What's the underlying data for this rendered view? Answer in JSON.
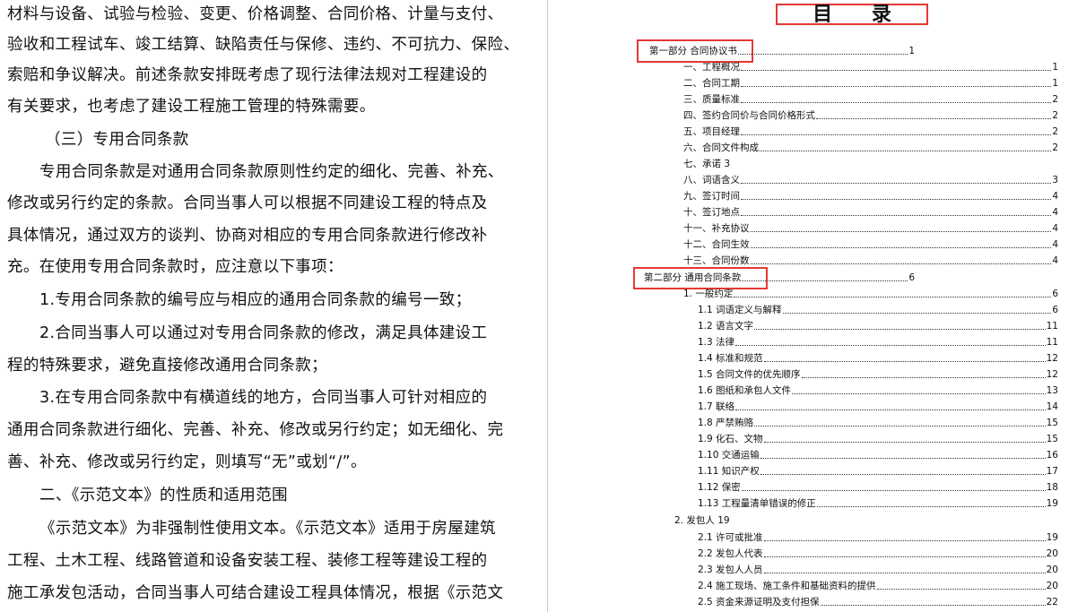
{
  "left_page": {
    "lines": [
      "材料与设备、试验与检验、变更、价格调整、合同价格、计量与支付、",
      "验收和工程试车、竣工结算、缺陷责任与保修、违约、不可抗力、保险、",
      "索赔和争议解决。前述条款安排既考虑了现行法律法规对工程建设的",
      "有关要求，也考虑了建设工程施工管理的特殊需要。",
      "（三）专用合同条款",
      "专用合同条款是对通用合同条款原则性约定的细化、完善、补充、",
      "修改或另行约定的条款。合同当事人可以根据不同建设工程的特点及",
      "具体情况，通过双方的谈判、协商对相应的专用合同条款进行修改补",
      "充。在使用专用合同条款时，应注意以下事项：",
      "1.专用合同条款的编号应与相应的通用合同条款的编号一致；",
      "2.合同当事人可以通过对专用合同条款的修改，满足具体建设工",
      "程的特殊要求，避免直接修改通用合同条款；",
      "3.在专用合同条款中有横道线的地方，合同当事人可针对相应的",
      "通用合同条款进行细化、完善、补充、修改或另行约定；如无细化、完",
      "善、补充、修改或另行约定，则填写“无”或划“/”。",
      "二、《示范文本》的性质和适用范围",
      "《示范文本》为非强制性使用文本。《示范文本》适用于房屋建筑",
      "工程、土木工程、线路管道和设备安装工程、装修工程等建设工程的",
      "施工承发包活动，合同当事人可结合建设工程具体情况，根据《示范文"
    ]
  },
  "toc": {
    "title": "目 录",
    "entries": [
      {
        "text": "第一部分  合同协议书",
        "page": "1"
      },
      {
        "text": "一、工程概况",
        "page": "1"
      },
      {
        "text": "二、合同工期",
        "page": "1"
      },
      {
        "text": "三、质量标准",
        "page": "2"
      },
      {
        "text": "四、签约合同价与合同价格形式",
        "page": "2"
      },
      {
        "text": "五、项目经理",
        "page": "2"
      },
      {
        "text": "六、合同文件构成",
        "page": "2"
      },
      {
        "text": "七、承诺 3",
        "page": ""
      },
      {
        "text": "八、词语含义",
        "page": "3"
      },
      {
        "text": "九、签订时间",
        "page": "4"
      },
      {
        "text": "十、签订地点",
        "page": "4"
      },
      {
        "text": "十一、补充协议",
        "page": "4"
      },
      {
        "text": "十二、合同生效",
        "page": "4"
      },
      {
        "text": "十三、合同份数",
        "page": "4"
      },
      {
        "text": "第二部分  通用合同条款",
        "page": "6"
      },
      {
        "text": "1. 一般约定",
        "page": "6"
      },
      {
        "text": "1.1 词语定义与解释",
        "page": "6"
      },
      {
        "text": "1.2 语言文字",
        "page": "11"
      },
      {
        "text": "1.3 法律",
        "page": "11"
      },
      {
        "text": "1.4  标准和规范",
        "page": "12"
      },
      {
        "text": "1.5  合同文件的优先顺序",
        "page": "12"
      },
      {
        "text": "1.6 图纸和承包人文件",
        "page": "13"
      },
      {
        "text": "1.7 联络",
        "page": "14"
      },
      {
        "text": "1.8 严禁贿赂",
        "page": "15"
      },
      {
        "text": "1.9 化石、文物",
        "page": "15"
      },
      {
        "text": "1.10 交通运输",
        "page": "16"
      },
      {
        "text": "1.11 知识产权",
        "page": "17"
      },
      {
        "text": "1.12 保密",
        "page": "18"
      },
      {
        "text": "1.13 工程量清单错误的修正",
        "page": "19"
      },
      {
        "text": "2. 发包人 19",
        "page": ""
      },
      {
        "text": "2.1  许可或批准",
        "page": "19"
      },
      {
        "text": "2.2  发包人代表",
        "page": "20"
      },
      {
        "text": "2.3 发包人人员",
        "page": "20"
      },
      {
        "text": "2.4  施工现场、施工条件和基础资料的提供",
        "page": "20"
      },
      {
        "text": "2.5  资金来源证明及支付担保",
        "page": "22"
      }
    ]
  }
}
